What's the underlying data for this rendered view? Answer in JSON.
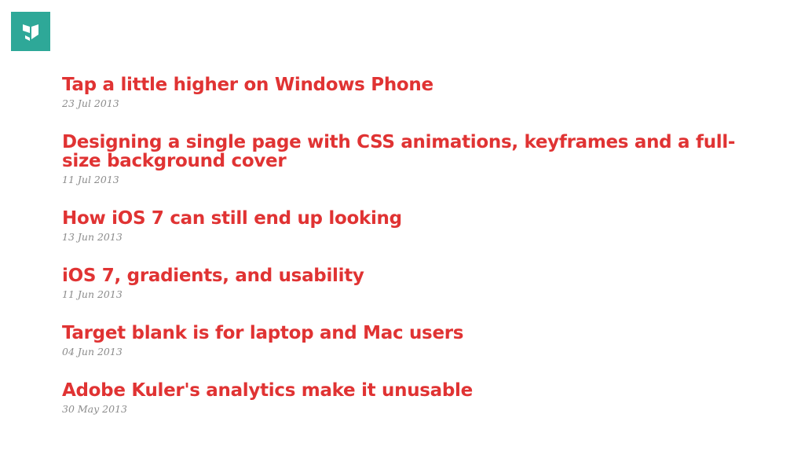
{
  "site": {
    "logo_icon": "site-logo-icon",
    "logo_color": "#2ea898"
  },
  "colors": {
    "title": "#e03333",
    "date": "#8c8c8c"
  },
  "posts": [
    {
      "title": "Tap a little higher on Windows Phone",
      "date": "23 Jul 2013"
    },
    {
      "title": "Designing a single page with CSS animations, keyframes and a full-size background cover",
      "date": "11 Jul 2013"
    },
    {
      "title": "How iOS 7 can still end up looking",
      "date": "13 Jun 2013"
    },
    {
      "title": "iOS 7, gradients, and usability",
      "date": "11 Jun 2013"
    },
    {
      "title": "Target blank is for laptop and Mac users",
      "date": "04 Jun 2013"
    },
    {
      "title": "Adobe Kuler's analytics make it unusable",
      "date": "30 May 2013"
    }
  ]
}
